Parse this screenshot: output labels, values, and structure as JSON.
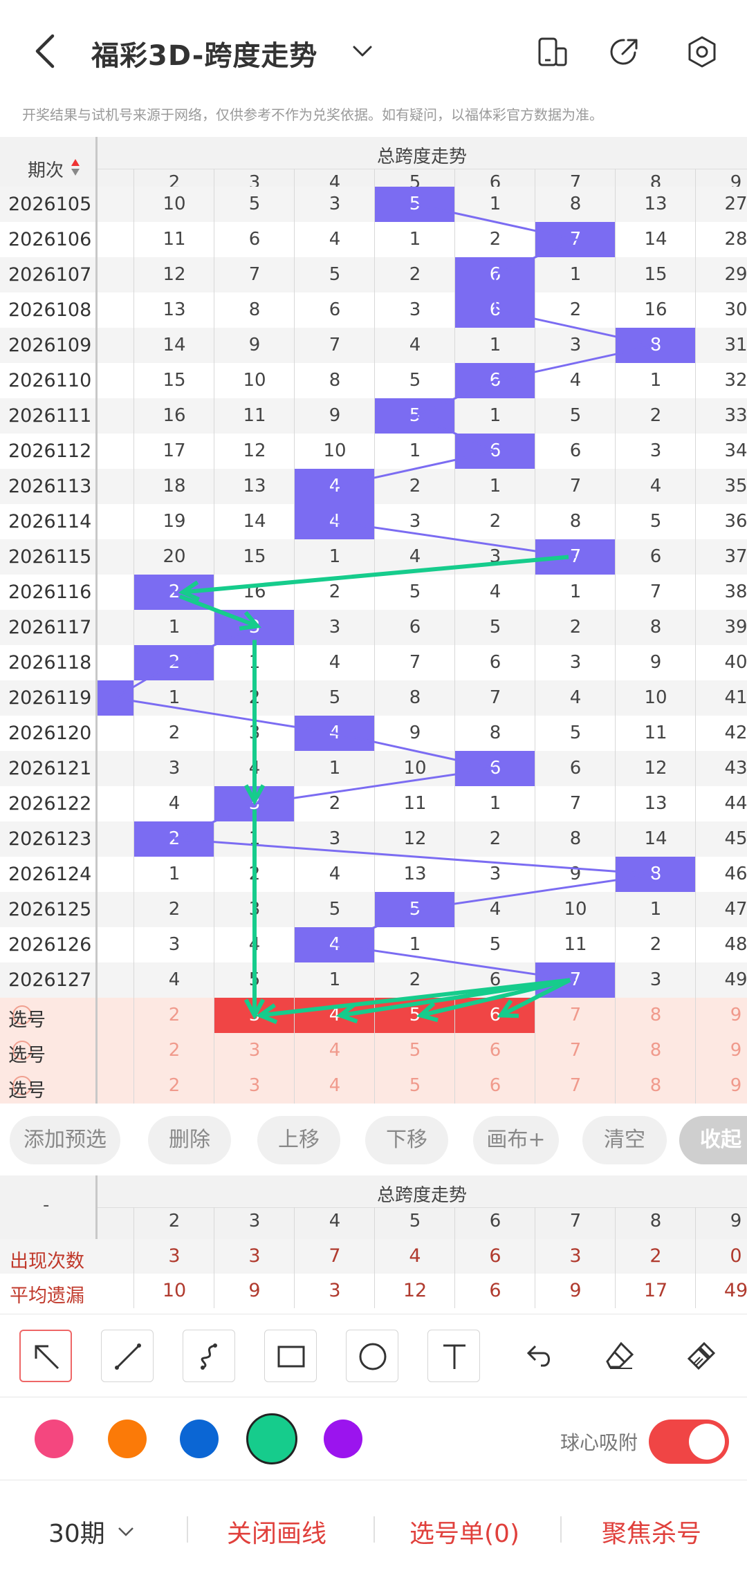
{
  "header": {
    "title": "福彩3D-跨度走势",
    "notice": "开奖结果与试机号来源于网络，仅供参考不作为兑奖依据。如有疑问，以福体彩官方数据为准。"
  },
  "grid": {
    "period_label": "期次",
    "group_title": "总跨度走势",
    "columns": [
      "2",
      "3",
      "4",
      "5",
      "6",
      "7",
      "8",
      "9"
    ],
    "rows": [
      {
        "period": "2026105",
        "cells": [
          "10",
          "5",
          "3",
          "5",
          "1",
          "8",
          "13",
          "27"
        ],
        "hit": 3
      },
      {
        "period": "2026106",
        "cells": [
          "11",
          "6",
          "4",
          "1",
          "2",
          "7",
          "14",
          "28"
        ],
        "hit": 5
      },
      {
        "period": "2026107",
        "cells": [
          "12",
          "7",
          "5",
          "2",
          "6",
          "1",
          "15",
          "29"
        ],
        "hit": 4
      },
      {
        "period": "2026108",
        "cells": [
          "13",
          "8",
          "6",
          "3",
          "6",
          "2",
          "16",
          "30"
        ],
        "hit": 4
      },
      {
        "period": "2026109",
        "cells": [
          "14",
          "9",
          "7",
          "4",
          "1",
          "3",
          "8",
          "31"
        ],
        "hit": 6
      },
      {
        "period": "2026110",
        "cells": [
          "15",
          "10",
          "8",
          "5",
          "6",
          "4",
          "1",
          "32"
        ],
        "hit": 4
      },
      {
        "period": "2026111",
        "cells": [
          "16",
          "11",
          "9",
          "5",
          "1",
          "5",
          "2",
          "33"
        ],
        "hit": 3
      },
      {
        "period": "2026112",
        "cells": [
          "17",
          "12",
          "10",
          "1",
          "6",
          "6",
          "3",
          "34"
        ],
        "hit": 4
      },
      {
        "period": "2026113",
        "cells": [
          "18",
          "13",
          "4",
          "2",
          "1",
          "7",
          "4",
          "35"
        ],
        "hit": 2
      },
      {
        "period": "2026114",
        "cells": [
          "19",
          "14",
          "4",
          "3",
          "2",
          "8",
          "5",
          "36"
        ],
        "hit": 2
      },
      {
        "period": "2026115",
        "cells": [
          "20",
          "15",
          "1",
          "4",
          "3",
          "7",
          "6",
          "37"
        ],
        "hit": 5
      },
      {
        "period": "2026116",
        "cells": [
          "2",
          "16",
          "2",
          "5",
          "4",
          "1",
          "7",
          "38"
        ],
        "hit": 0
      },
      {
        "period": "2026117",
        "cells": [
          "1",
          "3",
          "3",
          "6",
          "5",
          "2",
          "8",
          "39"
        ],
        "hit": 1
      },
      {
        "period": "2026118",
        "cells": [
          "2",
          "1",
          "4",
          "7",
          "6",
          "3",
          "9",
          "40"
        ],
        "hit": 0
      },
      {
        "period": "2026119",
        "cells": [
          "1",
          "2",
          "5",
          "8",
          "7",
          "4",
          "10",
          "41"
        ],
        "hit": -1
      },
      {
        "period": "2026120",
        "cells": [
          "2",
          "3",
          "4",
          "9",
          "8",
          "5",
          "11",
          "42"
        ],
        "hit": 2
      },
      {
        "period": "2026121",
        "cells": [
          "3",
          "4",
          "1",
          "10",
          "6",
          "6",
          "12",
          "43"
        ],
        "hit": 4
      },
      {
        "period": "2026122",
        "cells": [
          "4",
          "3",
          "2",
          "11",
          "1",
          "7",
          "13",
          "44"
        ],
        "hit": 1
      },
      {
        "period": "2026123",
        "cells": [
          "2",
          "1",
          "3",
          "12",
          "2",
          "8",
          "14",
          "45"
        ],
        "hit": 0
      },
      {
        "period": "2026124",
        "cells": [
          "1",
          "2",
          "4",
          "13",
          "3",
          "9",
          "8",
          "46"
        ],
        "hit": 6
      },
      {
        "period": "2026125",
        "cells": [
          "2",
          "3",
          "5",
          "5",
          "4",
          "10",
          "1",
          "47"
        ],
        "hit": 3
      },
      {
        "period": "2026126",
        "cells": [
          "3",
          "4",
          "4",
          "1",
          "5",
          "11",
          "2",
          "48"
        ],
        "hit": 2
      },
      {
        "period": "2026127",
        "cells": [
          "4",
          "5",
          "1",
          "2",
          "6",
          "7",
          "3",
          "49"
        ],
        "hit": 5
      }
    ],
    "select_label": "选号",
    "select_rows": [
      {
        "cells": [
          "2",
          "3",
          "4",
          "5",
          "6",
          "7",
          "8",
          "9"
        ],
        "red": [
          1,
          2,
          3,
          4
        ]
      },
      {
        "cells": [
          "2",
          "3",
          "4",
          "5",
          "6",
          "7",
          "8",
          "9"
        ],
        "red": []
      },
      {
        "cells": [
          "2",
          "3",
          "4",
          "5",
          "6",
          "7",
          "8",
          "9"
        ],
        "red": []
      }
    ]
  },
  "actions": {
    "add_preselect": "添加预选",
    "delete": "删除",
    "move_up": "上移",
    "move_down": "下移",
    "canvas_plus": "画布+",
    "clear": "清空",
    "collapse": "收起"
  },
  "stats": {
    "left_label": "-",
    "group_title": "总跨度走势",
    "columns": [
      "2",
      "3",
      "4",
      "5",
      "6",
      "7",
      "8",
      "9"
    ],
    "rows": [
      {
        "label": "出现次数",
        "values": [
          "3",
          "3",
          "7",
          "4",
          "6",
          "3",
          "2",
          "0"
        ]
      },
      {
        "label": "平均遗漏",
        "values": [
          "10",
          "9",
          "3",
          "12",
          "6",
          "9",
          "17",
          "49"
        ]
      }
    ]
  },
  "draw_tools": [
    "arrow-tool",
    "line-tool",
    "curve-tool",
    "rectangle-tool",
    "circle-tool",
    "text-tool",
    "undo-tool",
    "eraser-tool",
    "clear-brush-tool"
  ],
  "colors": {
    "options": [
      "#f4477f",
      "#fb7a08",
      "#0b66d4",
      "#16cc8c",
      "#9b14ee"
    ],
    "selected": "#16cc8c",
    "accent_red": "#f04545",
    "hit_purple": "#7b6cf2"
  },
  "snap": {
    "label": "球心吸附",
    "enabled": true
  },
  "bottom": {
    "periods": "30期",
    "close_draw": "关闭画线",
    "pick_list": "选号单(0)",
    "focus_kill": "聚焦杀号"
  }
}
